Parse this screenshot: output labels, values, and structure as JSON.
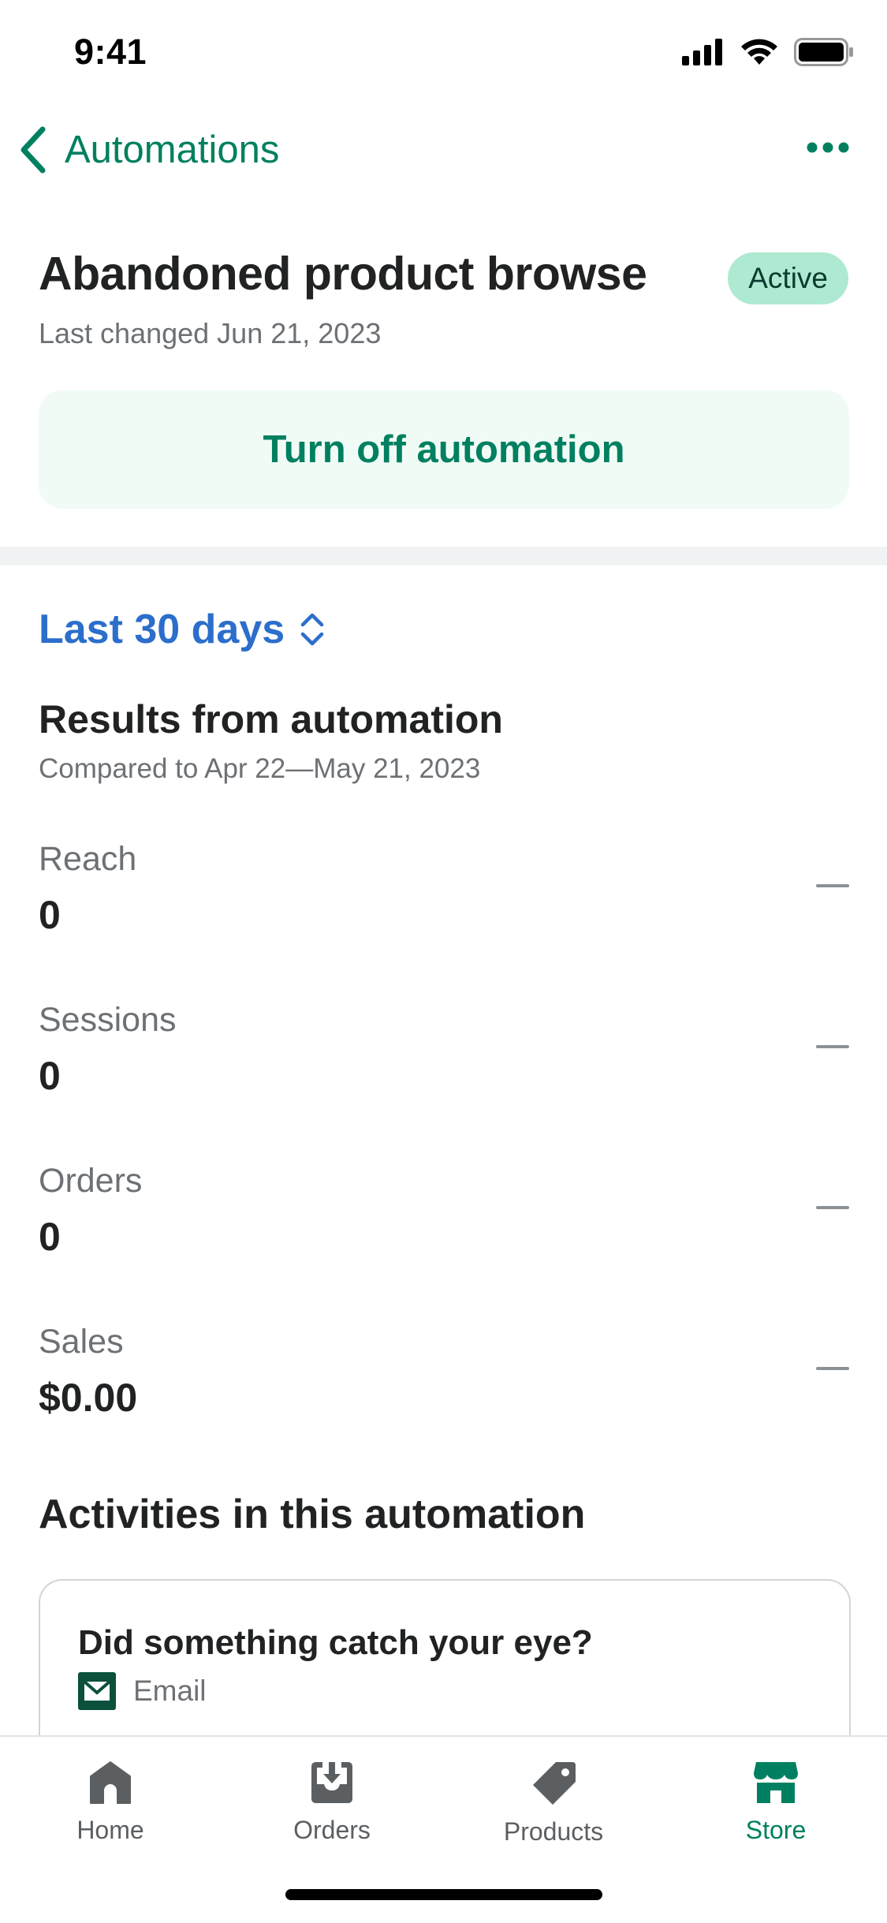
{
  "status_bar": {
    "time": "9:41"
  },
  "nav": {
    "back_label": "Automations"
  },
  "header": {
    "title": "Abandoned product browse",
    "badge": "Active",
    "subtitle": "Last changed Jun 21, 2023",
    "toggle_label": "Turn off automation"
  },
  "results": {
    "range_label": "Last 30 days",
    "title": "Results from automation",
    "compare": "Compared to Apr 22—May 21, 2023",
    "metrics": [
      {
        "label": "Reach",
        "value": "0"
      },
      {
        "label": "Sessions",
        "value": "0"
      },
      {
        "label": "Orders",
        "value": "0"
      },
      {
        "label": "Sales",
        "value": "$0.00"
      }
    ]
  },
  "activities": {
    "title": "Activities in this automation",
    "items": [
      {
        "title": "Did something catch your eye?",
        "type": "Email",
        "icon": "mail-icon"
      }
    ]
  },
  "tabbar": {
    "items": [
      {
        "label": "Home",
        "icon": "home-icon"
      },
      {
        "label": "Orders",
        "icon": "orders-icon"
      },
      {
        "label": "Products",
        "icon": "tag-icon"
      },
      {
        "label": "Store",
        "icon": "store-icon"
      }
    ],
    "active": "Store"
  },
  "colors": {
    "accent": "#008060",
    "link": "#2c6ecb",
    "badge_bg": "#aee9d1",
    "button_bg": "#f1fbf6"
  }
}
